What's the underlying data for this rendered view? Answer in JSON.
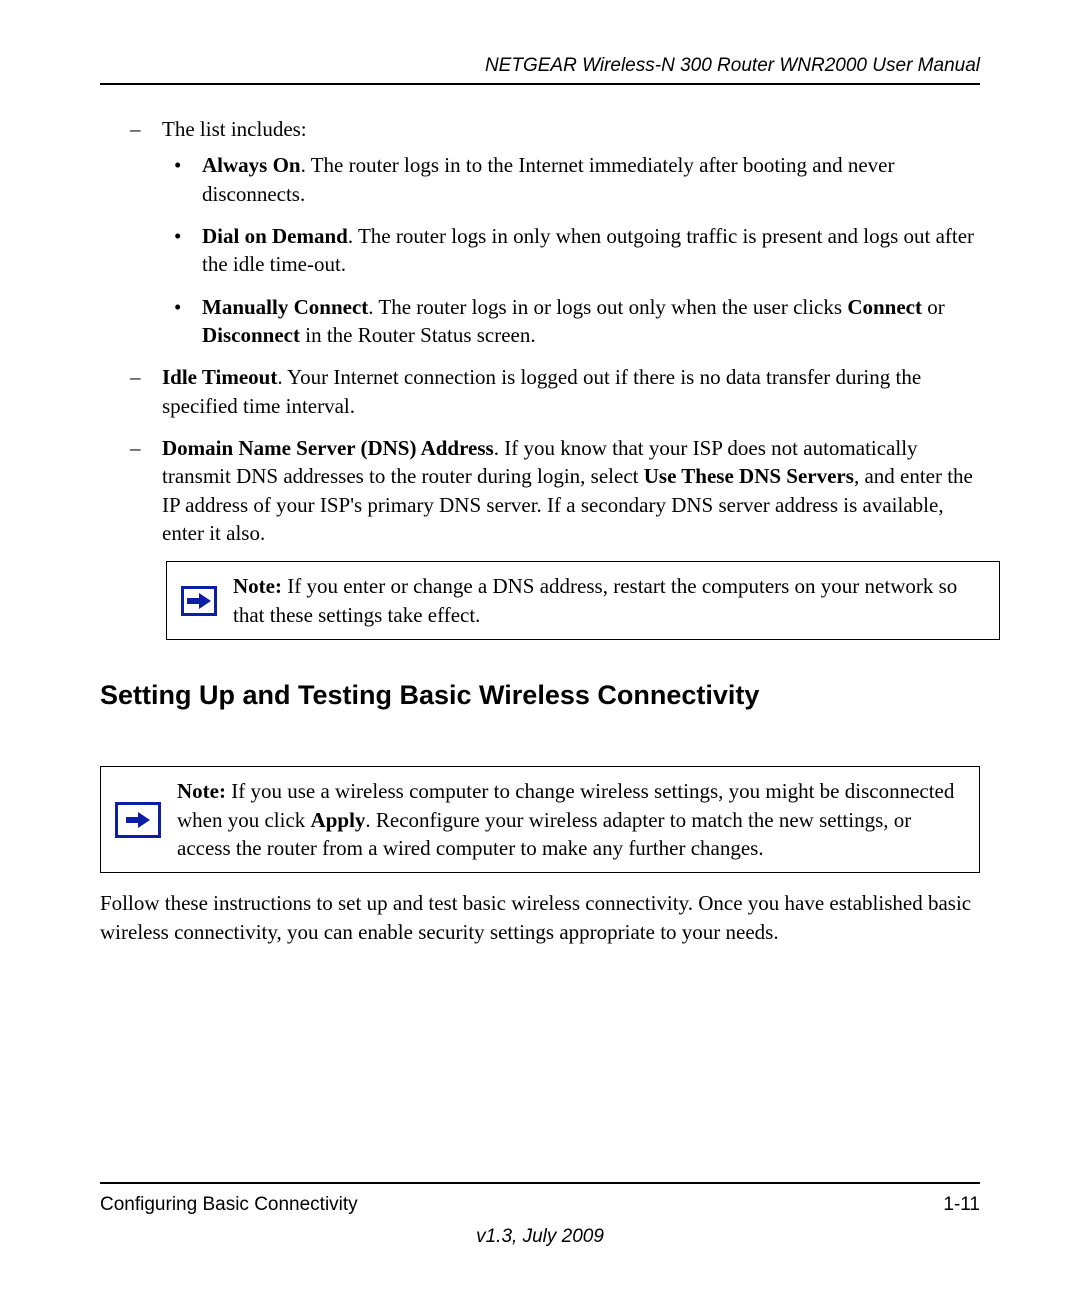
{
  "header": {
    "title": "NETGEAR Wireless-N 300 Router WNR2000 User Manual"
  },
  "content": {
    "list_intro": "The list includes:",
    "always_on_label": "Always On",
    "always_on_text": ". The router logs in to the Internet immediately after booting and never disconnects.",
    "dial_label": "Dial on Demand",
    "dial_text": ". The router logs in only when outgoing traffic is present and logs out after the idle time-out.",
    "manual_label": "Manually Connect",
    "manual_text1": ". The router logs in or logs out only when the user clicks ",
    "manual_connect": "Connect",
    "manual_or": " or ",
    "manual_disconnect": "Disconnect",
    "manual_text2": " in the Router Status screen.",
    "idle_label": "Idle Timeout",
    "idle_text": ". Your Internet connection is logged out if there is no data transfer during the specified time interval.",
    "dns_label": "Domain Name Server (DNS) Address",
    "dns_text1": ". If you know that your ISP does not automatically transmit DNS addresses to the router during login, select ",
    "dns_bold": "Use These DNS Servers",
    "dns_text2": ", and enter the IP address of your ISP's primary DNS server. If a secondary DNS server address is available, enter it also.",
    "note1_label": "Note:",
    "note1_text": " If you enter or change a DNS address, restart the computers on your network so that these settings take effect.",
    "section_heading": "Setting Up and Testing Basic Wireless Connectivity",
    "note2_label": "Note:",
    "note2_text1": " If you use a wireless computer to change wireless settings, you might be disconnected when you click ",
    "note2_apply": "Apply",
    "note2_text2": ". Reconfigure your wireless adapter to match the new settings, or access the router from a wired computer to make any further changes.",
    "follow_text": "Follow these instructions to set up and test basic wireless connectivity. Once you have established basic wireless connectivity, you can enable security settings appropriate to your needs."
  },
  "footer": {
    "section": "Configuring Basic Connectivity",
    "page": "1-11",
    "version": "v1.3, July 2009"
  }
}
